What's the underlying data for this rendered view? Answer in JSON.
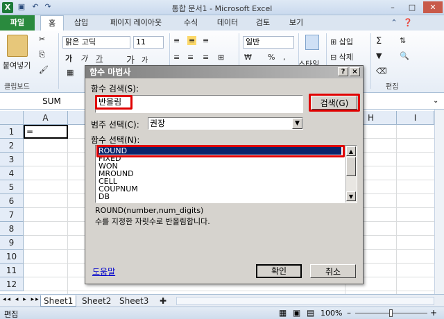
{
  "window": {
    "title": "통합 문서1 - Microsoft Excel",
    "quick_access": [
      "↶",
      "↷"
    ],
    "buttons": {
      "minimize": "–",
      "maximize": "□",
      "close": "✕"
    }
  },
  "tabs": [
    "파일",
    "홈",
    "삽입",
    "페이지 레이아웃",
    "수식",
    "데이터",
    "검토",
    "보기"
  ],
  "ribbon": {
    "paste_label": "붙여넣기",
    "clipboard_label": "클립보드",
    "font_name": "맑은 고딕",
    "font_size": "11",
    "bold": "가",
    "italic": "가",
    "underline": "가",
    "grow": "가",
    "shrink": "가",
    "number_format": "일반",
    "percent": "%",
    "comma": ",",
    "style_label": "스타일",
    "insert_label": "삽입",
    "delete_label": "삭제",
    "edit_label": "편집",
    "sum": "Σ"
  },
  "formula_bar": {
    "name_box": "SUM",
    "formula": ""
  },
  "grid": {
    "columns": [
      "A",
      "H",
      "I"
    ],
    "rows": [
      "1",
      "2",
      "3",
      "4",
      "5",
      "6",
      "7",
      "8",
      "9",
      "10",
      "11",
      "12"
    ],
    "cell_a1": "="
  },
  "sheets": [
    "Sheet1",
    "Sheet2",
    "Sheet3"
  ],
  "status": {
    "mode": "편집",
    "zoom": "100%",
    "zoom_minus": "–",
    "zoom_plus": "+"
  },
  "dialog": {
    "title": "함수 마법사",
    "help_btn": "?",
    "close_btn": "×",
    "search_label": "함수 검색(S):",
    "search_value": "반올림",
    "search_button": "검색(G)",
    "category_label": "범주 선택(C):",
    "category_value": "권장",
    "select_label": "함수 선택(N):",
    "functions": [
      "ROUND",
      "FIXED",
      "WON",
      "MROUND",
      "CELL",
      "COUPNUM",
      "DB"
    ],
    "selected_index": 0,
    "syntax": "ROUND(number,num_digits)",
    "description": "수를 지정한 자릿수로 반올림합니다.",
    "help_link": "도움말",
    "ok_button": "확인",
    "cancel_button": "취소"
  }
}
